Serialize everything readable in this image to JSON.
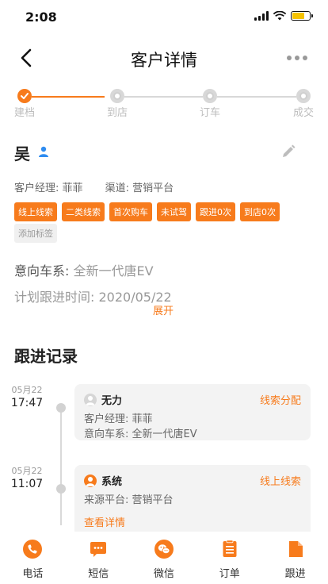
{
  "status_bar": {
    "time": "2:08"
  },
  "nav": {
    "title": "客户详情"
  },
  "steps": [
    {
      "label": "建档",
      "state": "done"
    },
    {
      "label": "到店",
      "state": "pending"
    },
    {
      "label": "订车",
      "state": "pending"
    },
    {
      "label": "成交",
      "state": "pending"
    }
  ],
  "customer": {
    "name": "吴",
    "manager": "客户经理: 菲菲",
    "channel": "渠道: 营销平台",
    "tags": [
      "线上线索",
      "二类线索",
      "首次购车",
      "未试驾",
      "跟进0次",
      "到店0次"
    ],
    "add_tag": "添加标签",
    "intent_label": "意向车系: ",
    "intent_value": "全新一代唐EV",
    "plan_label": "计划跟进时间: ",
    "plan_value": "2020/05/22",
    "expand": "展开"
  },
  "follow": {
    "title": "跟进记录",
    "records": [
      {
        "date": "05月22",
        "time": "17:47",
        "who": "无力",
        "tag": "线索分配",
        "lines": [
          "客户经理: 菲菲",
          "意向车系: 全新一代唐EV"
        ]
      },
      {
        "date": "05月22",
        "time": "11:07",
        "who": "系统",
        "tag": "线上线索",
        "lines": [
          "来源平台: 营销平台"
        ],
        "link": "查看详情"
      }
    ]
  },
  "tabbar": [
    {
      "label": "电话",
      "icon": "phone-icon"
    },
    {
      "label": "短信",
      "icon": "sms-icon"
    },
    {
      "label": "微信",
      "icon": "wechat-icon"
    },
    {
      "label": "订单",
      "icon": "order-icon"
    },
    {
      "label": "跟进",
      "icon": "follow-icon"
    }
  ],
  "colors": {
    "accent": "#f77b1c",
    "inactive": "#d8d8d8"
  }
}
